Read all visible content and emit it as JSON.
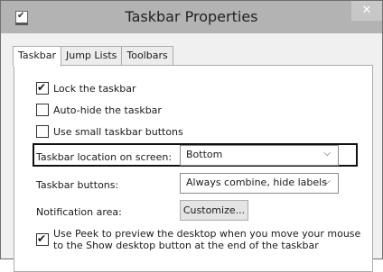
{
  "window": {
    "title": "Taskbar Properties",
    "close_glyph": "✕",
    "app_icon": "taskbar-app-icon"
  },
  "tabs": [
    {
      "label": "Taskbar",
      "active": true
    },
    {
      "label": "Jump Lists",
      "active": false
    },
    {
      "label": "Toolbars",
      "active": false
    }
  ],
  "checkboxes": {
    "lock": {
      "label": "Lock the taskbar",
      "checked": true
    },
    "autohide": {
      "label": "Auto-hide the taskbar",
      "checked": false
    },
    "small": {
      "label": "Use small taskbar buttons",
      "checked": false
    },
    "peek": {
      "label": "Use Peek to preview the desktop when you move your mouse to the Show desktop button at the end of the taskbar",
      "checked": true
    }
  },
  "location": {
    "label": "Taskbar location on screen:",
    "value": "Bottom"
  },
  "buttons_setting": {
    "label": "Taskbar buttons:",
    "value": "Always combine, hide labels"
  },
  "notification": {
    "label": "Notification area:",
    "button": "Customize..."
  },
  "glyphs": {
    "check": "✔",
    "chevron": "⌵"
  }
}
